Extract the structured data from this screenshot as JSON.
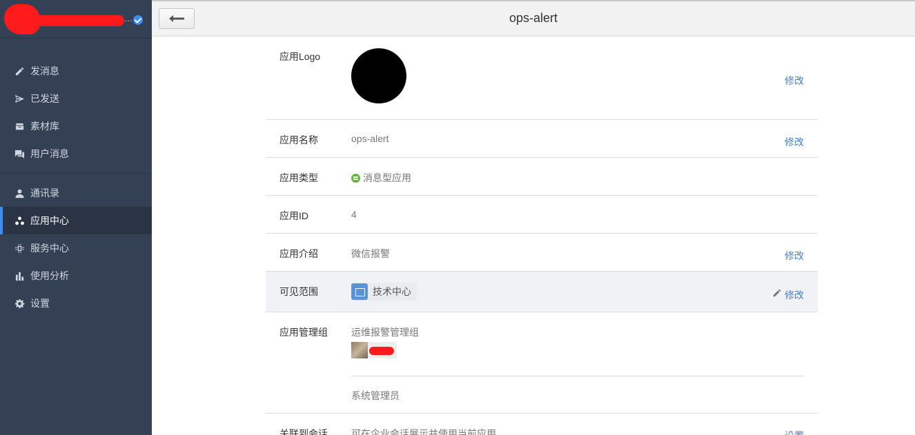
{
  "sidebar": {
    "ellipsis": "…",
    "group1": [
      {
        "label": "发消息",
        "icon": "pencil-icon"
      },
      {
        "label": "已发送",
        "icon": "send-icon"
      },
      {
        "label": "素材库",
        "icon": "archive-icon"
      },
      {
        "label": "用户消息",
        "icon": "chat-icon"
      }
    ],
    "group2": [
      {
        "label": "通讯录",
        "icon": "user-icon"
      },
      {
        "label": "应用中心",
        "icon": "apps-icon",
        "active": true
      },
      {
        "label": "服务中心",
        "icon": "chip-icon"
      },
      {
        "label": "使用分析",
        "icon": "bar-chart-icon"
      },
      {
        "label": "设置",
        "icon": "gear-icon"
      }
    ]
  },
  "header": {
    "title": "ops-alert"
  },
  "details": {
    "logo": {
      "label": "应用Logo",
      "edit": "修改"
    },
    "name": {
      "label": "应用名称",
      "value": "ops-alert",
      "edit": "修改"
    },
    "type": {
      "label": "应用类型",
      "value": "消息型应用"
    },
    "id": {
      "label": "应用ID",
      "value": "4"
    },
    "intro": {
      "label": "应用介绍",
      "value": "微信报警",
      "edit": "修改"
    },
    "scope": {
      "label": "可见范围",
      "value": "技术中心",
      "edit": "修改"
    },
    "admin": {
      "label": "应用管理组",
      "group_name": "运维报警管理组",
      "role": "系统管理员"
    },
    "session": {
      "label": "关联到会话",
      "value": "可在企业会话展示并使用当前应用",
      "edit": "设置"
    }
  },
  "colors": {
    "sidebar_bg": "#344155",
    "accent": "#3d8df0",
    "link": "#4a7fc1",
    "app_type_green": "#61b93a"
  }
}
